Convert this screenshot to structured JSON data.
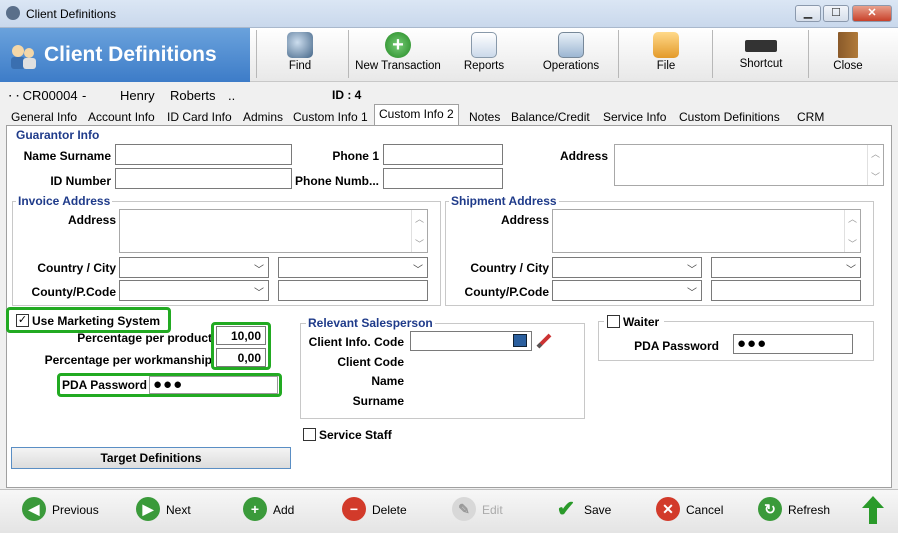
{
  "window": {
    "title": "Client Definitions",
    "minimize": "▁",
    "maximize": "☐",
    "close": "✕"
  },
  "header": {
    "title": "Client Definitions"
  },
  "toolbar": {
    "find": "Find",
    "new_transaction": "New Transaction",
    "reports": "Reports",
    "operations": "Operations",
    "file": "File",
    "shortcut": "Shortcut",
    "close": "Close"
  },
  "client": {
    "code": "CR00004",
    "sep1": "-",
    "first_name": "Henry",
    "last_name": "Roberts",
    "sep2": "..",
    "id_label": "ID : 4"
  },
  "tabs": [
    "General Info",
    "Account Info",
    "ID Card Info",
    "Admins",
    "Custom Info 1",
    "Custom Info 2",
    "Notes",
    "Balance/Credit",
    "Service Info",
    "Custom Definitions",
    "CRM"
  ],
  "guarantor": {
    "title": "Guarantor Info",
    "name_label": "Name Surname",
    "id_label": "ID Number",
    "phone1_label": "Phone 1",
    "phone2_label": "Phone Numb...",
    "address_label": "Address"
  },
  "invoice": {
    "title": "Invoice Address",
    "address_label": "Address",
    "country_label": "Country / City",
    "county_label": "County/P.Code"
  },
  "shipment": {
    "title": "Shipment Address",
    "address_label": "Address",
    "country_label": "Country / City",
    "county_label": "County/P.Code"
  },
  "marketing": {
    "use_label": "Use Marketing System",
    "use_checked": "✓",
    "pct_product_label": "Percentage per product",
    "pct_product_value": "10,00",
    "pct_work_label": "Percentage per workmanship",
    "pct_work_value": "0,00",
    "pda_label": "PDA Password",
    "pda_value": "●●●",
    "target_button": "Target Definitions"
  },
  "salesperson": {
    "title": "Relevant Salesperson",
    "code_label": "Client Info. Code",
    "client_code_label": "Client Code",
    "name_label": "Name",
    "surname_label": "Surname",
    "service_staff_label": "Service Staff"
  },
  "waiter": {
    "label": "Waiter",
    "pda_label": "PDA Password",
    "pda_value": "●●●"
  },
  "bottom": {
    "previous": "Previous",
    "next": "Next",
    "add": "Add",
    "delete": "Delete",
    "edit": "Edit",
    "save": "Save",
    "cancel": "Cancel",
    "refresh": "Refresh"
  },
  "colors": {
    "accent_green": "#22aa22",
    "header_blue": "#3d7cc8",
    "group_title": "#1f3b8a"
  }
}
